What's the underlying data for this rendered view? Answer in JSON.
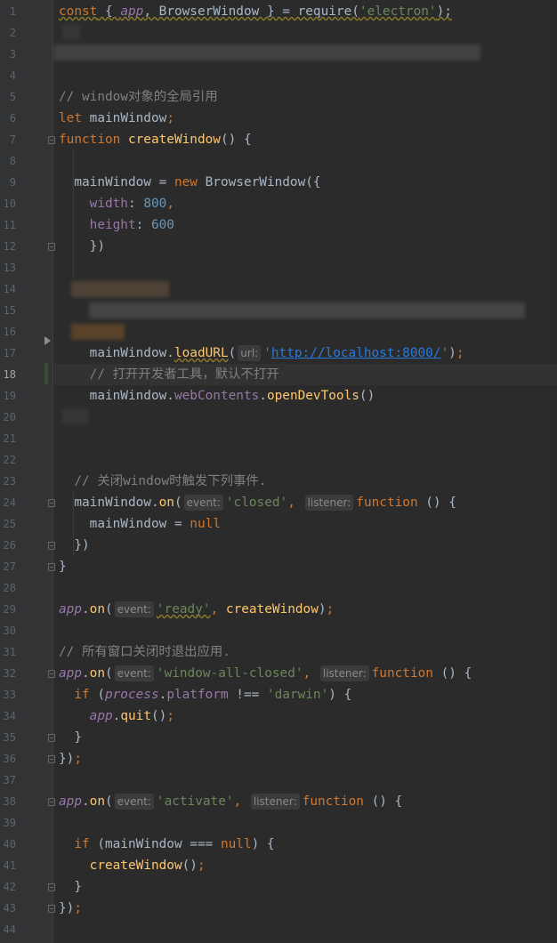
{
  "editor": {
    "language": "javascript",
    "current_line": 18,
    "hint_labels": {
      "url": "url:",
      "event": "event:",
      "listener": "listener:"
    },
    "lines": [
      {
        "n": "1",
        "tokens": [
          [
            "kw",
            "const"
          ],
          [
            "txt",
            " { "
          ],
          [
            "var",
            "app"
          ],
          [
            "txt",
            ", BrowserWindow } = require("
          ],
          [
            "str",
            "'electron'"
          ],
          [
            "txt",
            ");"
          ]
        ]
      },
      {
        "n": "2",
        "tokens": []
      },
      {
        "n": "3",
        "tokens": []
      },
      {
        "n": "4",
        "tokens": []
      },
      {
        "n": "5",
        "tokens": [
          [
            "cmt",
            "// window对象的全局引用"
          ]
        ]
      },
      {
        "n": "6",
        "tokens": [
          [
            "kw",
            "let"
          ],
          [
            "txt",
            " mainWindow"
          ],
          [
            "kw",
            ";"
          ]
        ]
      },
      {
        "n": "7",
        "tokens": [
          [
            "kw",
            "function"
          ],
          [
            "txt",
            " "
          ],
          [
            "fn",
            "createWindow"
          ],
          [
            "txt",
            "() {"
          ]
        ]
      },
      {
        "n": "8",
        "tokens": []
      },
      {
        "n": "9",
        "tokens": [
          [
            "txt",
            "  mainWindow = "
          ],
          [
            "kw",
            "new"
          ],
          [
            "txt",
            " BrowserWindow({"
          ]
        ]
      },
      {
        "n": "10",
        "tokens": [
          [
            "txt",
            "    "
          ],
          [
            "prop",
            "width"
          ],
          [
            "txt",
            ": "
          ],
          [
            "num",
            "800"
          ],
          [
            "kw",
            ","
          ]
        ]
      },
      {
        "n": "11",
        "tokens": [
          [
            "txt",
            "    "
          ],
          [
            "prop",
            "height"
          ],
          [
            "txt",
            ": "
          ],
          [
            "num",
            "600"
          ]
        ]
      },
      {
        "n": "12",
        "tokens": [
          [
            "txt",
            "    })"
          ]
        ]
      },
      {
        "n": "13",
        "tokens": []
      },
      {
        "n": "14",
        "tokens": []
      },
      {
        "n": "15",
        "tokens": []
      },
      {
        "n": "16",
        "tokens": []
      },
      {
        "n": "17",
        "tokens": [
          [
            "txt",
            "    mainWindow."
          ],
          [
            "fn",
            "loadURL"
          ],
          [
            "txt",
            "("
          ],
          [
            "hint_url",
            ""
          ],
          [
            "str",
            "'"
          ],
          [
            "lnk",
            "http://localhost:8000/"
          ],
          [
            "str",
            "'"
          ],
          [
            "txt",
            ")"
          ],
          [
            "kw",
            ";"
          ]
        ]
      },
      {
        "n": "18",
        "tokens": [
          [
            "txt",
            "    "
          ],
          [
            "cmt",
            "// 打开开发者工具，默认不打开"
          ]
        ]
      },
      {
        "n": "19",
        "tokens": [
          [
            "txt",
            "    mainWindow."
          ],
          [
            "prop",
            "webContents"
          ],
          [
            "txt",
            "."
          ],
          [
            "fn",
            "openDevTools"
          ],
          [
            "txt",
            "()"
          ]
        ]
      },
      {
        "n": "20",
        "tokens": []
      },
      {
        "n": "21",
        "tokens": []
      },
      {
        "n": "22",
        "tokens": []
      },
      {
        "n": "23",
        "tokens": [
          [
            "txt",
            "  "
          ],
          [
            "cmt",
            "// 关闭window时触发下列事件."
          ]
        ]
      },
      {
        "n": "24",
        "tokens": [
          [
            "txt",
            "  mainWindow."
          ],
          [
            "fn",
            "on"
          ],
          [
            "txt",
            "("
          ],
          [
            "hint_event",
            ""
          ],
          [
            "str",
            "'closed'"
          ],
          [
            "kw",
            ","
          ],
          [
            "txt",
            " "
          ],
          [
            "hint_listener",
            ""
          ],
          [
            "kw",
            "function"
          ],
          [
            "txt",
            " () {"
          ]
        ]
      },
      {
        "n": "25",
        "tokens": [
          [
            "txt",
            "    mainWindow = "
          ],
          [
            "kw",
            "null"
          ]
        ]
      },
      {
        "n": "26",
        "tokens": [
          [
            "txt",
            "  })"
          ]
        ]
      },
      {
        "n": "27",
        "tokens": [
          [
            "txt",
            "}"
          ]
        ]
      },
      {
        "n": "28",
        "tokens": []
      },
      {
        "n": "29",
        "tokens": [
          [
            "var",
            "app"
          ],
          [
            "txt",
            "."
          ],
          [
            "fn",
            "on"
          ],
          [
            "txt",
            "("
          ],
          [
            "hint_event",
            ""
          ],
          [
            "str",
            "'ready'"
          ],
          [
            "kw",
            ","
          ],
          [
            "txt",
            " "
          ],
          [
            "fn",
            "createWindow"
          ],
          [
            "txt",
            ")"
          ],
          [
            "kw",
            ";"
          ]
        ]
      },
      {
        "n": "30",
        "tokens": []
      },
      {
        "n": "31",
        "tokens": [
          [
            "cmt",
            "// 所有窗口关闭时退出应用."
          ]
        ]
      },
      {
        "n": "32",
        "tokens": [
          [
            "var",
            "app"
          ],
          [
            "txt",
            "."
          ],
          [
            "fn",
            "on"
          ],
          [
            "txt",
            "("
          ],
          [
            "hint_event",
            ""
          ],
          [
            "str",
            "'window-all-closed'"
          ],
          [
            "kw",
            ","
          ],
          [
            "txt",
            " "
          ],
          [
            "hint_listener",
            ""
          ],
          [
            "kw",
            "function"
          ],
          [
            "txt",
            " () {"
          ]
        ]
      },
      {
        "n": "33",
        "tokens": [
          [
            "txt",
            "  "
          ],
          [
            "kw",
            "if"
          ],
          [
            "txt",
            " ("
          ],
          [
            "var",
            "process"
          ],
          [
            "txt",
            "."
          ],
          [
            "prop",
            "platform"
          ],
          [
            "txt",
            " !== "
          ],
          [
            "str",
            "'darwin'"
          ],
          [
            "txt",
            ") {"
          ]
        ]
      },
      {
        "n": "34",
        "tokens": [
          [
            "txt",
            "    "
          ],
          [
            "var",
            "app"
          ],
          [
            "txt",
            "."
          ],
          [
            "fn",
            "quit"
          ],
          [
            "txt",
            "()"
          ],
          [
            "kw",
            ";"
          ]
        ]
      },
      {
        "n": "35",
        "tokens": [
          [
            "txt",
            "  }"
          ]
        ]
      },
      {
        "n": "36",
        "tokens": [
          [
            "txt",
            "})"
          ],
          [
            "kw",
            ";"
          ]
        ]
      },
      {
        "n": "37",
        "tokens": []
      },
      {
        "n": "38",
        "tokens": [
          [
            "var",
            "app"
          ],
          [
            "txt",
            "."
          ],
          [
            "fn",
            "on"
          ],
          [
            "txt",
            "("
          ],
          [
            "hint_event",
            ""
          ],
          [
            "str",
            "'activate'"
          ],
          [
            "kw",
            ","
          ],
          [
            "txt",
            " "
          ],
          [
            "hint_listener",
            ""
          ],
          [
            "kw",
            "function"
          ],
          [
            "txt",
            " () {"
          ]
        ]
      },
      {
        "n": "39",
        "tokens": []
      },
      {
        "n": "40",
        "tokens": [
          [
            "txt",
            "  "
          ],
          [
            "kw",
            "if"
          ],
          [
            "txt",
            " (mainWindow === "
          ],
          [
            "kw",
            "null"
          ],
          [
            "txt",
            ") {"
          ]
        ]
      },
      {
        "n": "41",
        "tokens": [
          [
            "txt",
            "    "
          ],
          [
            "fn",
            "createWindow"
          ],
          [
            "txt",
            "()"
          ],
          [
            "kw",
            ";"
          ]
        ]
      },
      {
        "n": "42",
        "tokens": [
          [
            "txt",
            "  }"
          ]
        ]
      },
      {
        "n": "43",
        "tokens": [
          [
            "txt",
            "})"
          ],
          [
            "kw",
            ";"
          ]
        ]
      },
      {
        "n": "44",
        "tokens": []
      }
    ]
  },
  "colors": {
    "background": "#2b2b2b",
    "gutter": "#313335",
    "keyword": "#cc7832",
    "string": "#6a8759",
    "number": "#6897bb",
    "comment": "#808080",
    "function": "#ffc66d",
    "property": "#9876aa",
    "text": "#a9b7c6",
    "link": "#287bde"
  },
  "icons": {
    "gutter_bulb": "lightbulb-icon",
    "gutter_arrow": "bookmark-arrow-icon",
    "fold_markers": "fold-marker-icon"
  }
}
